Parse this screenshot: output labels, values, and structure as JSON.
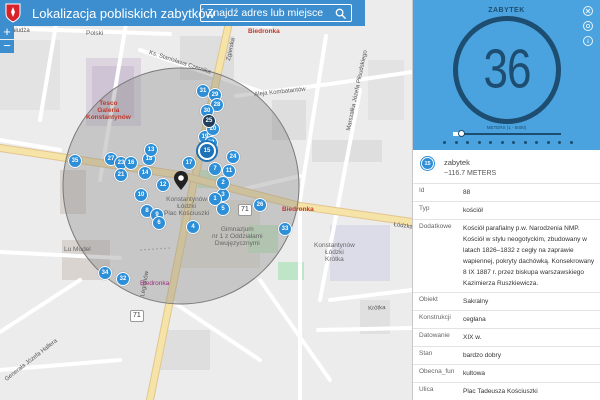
{
  "app": {
    "title": "Lokalizacja pobliskich zabytków",
    "search_label": "Znajdź adres lub miejsce"
  },
  "zoom": {
    "in_label": "+",
    "out_label": "−"
  },
  "map": {
    "pois": {
      "biedronka_top": "Biedronka",
      "biedronka_right": "Biedronka",
      "biedronka_bottom": "Biedronka",
      "tesco": "Tesco\nGaleria\nKonstantynów",
      "gimnazjum": "Gimnazjum\nnr 1 z Oddziałami\nDwujęzycznymi",
      "plac": "Konstantynów\nŁódzki\nPlac Kościuszki",
      "konstantynow_right": "Konstantynów\nŁódzki\nKrótka",
      "polski": "Polski",
      "lu_model": "Lu Model"
    },
    "streets": {
      "saturn": "Sałudża",
      "czernika": "Ks. Stanisława Czernika",
      "kombatantow": "Aleja Kombatantów",
      "zgierska": "Zgierska",
      "lodzka": "Łódzka",
      "legionow": "Legionów",
      "krotka": "Krótka",
      "gen": "Generała Józefa Hallera",
      "marszalka": "Marszałka Józefa Piłsudskiego"
    },
    "road_numbers": [
      "71",
      "71"
    ],
    "colors": {
      "marker": "#2e8fd9",
      "marker_dark": "#1f3f5c",
      "buffer": "#8c8c8c"
    }
  },
  "markers": [
    {
      "label": "35"
    },
    {
      "label": "27"
    },
    {
      "label": "23"
    },
    {
      "label": "16"
    },
    {
      "label": "18"
    },
    {
      "label": "13"
    },
    {
      "label": "21"
    },
    {
      "label": "10"
    },
    {
      "label": "14"
    },
    {
      "label": "12"
    },
    {
      "label": "8"
    },
    {
      "label": "9"
    },
    {
      "label": "6"
    },
    {
      "label": "5"
    },
    {
      "label": "4"
    },
    {
      "label": "3"
    },
    {
      "label": "2"
    },
    {
      "label": "1"
    },
    {
      "label": "7"
    },
    {
      "label": "11"
    },
    {
      "label": "17"
    },
    {
      "label": "19"
    },
    {
      "label": "20"
    },
    {
      "label": "22"
    },
    {
      "label": "26"
    },
    {
      "label": "33"
    },
    {
      "label": "34"
    },
    {
      "label": "32"
    },
    {
      "label": "31"
    },
    {
      "label": "29"
    },
    {
      "label": "28"
    },
    {
      "label": "30"
    },
    {
      "label": "25"
    },
    {
      "label": "24"
    }
  ],
  "panel": {
    "title": "ZABYTEK",
    "counter": "36",
    "slider_label": "METERS (1 - 5000)",
    "slider_fraction": 0.08,
    "item": {
      "number": "15",
      "type": "zabytek",
      "distance": "~116.7 METERS"
    },
    "attributes": [
      {
        "key": "Id",
        "value": "88"
      },
      {
        "key": "Typ",
        "value": "kościół"
      },
      {
        "key": "Dodatkowe",
        "value": "Kościół parafialny p.w. Narodzenia NMP. Kościół w stylu neogotyckim, zbudowany w latach 1826–1832 z cegły na zaprawie wapiennej, pokryty dachówką. Konsekrowany 8 IX 1887 r. przez biskupa warszawskiego Kazimierza Ruszkiewicza."
      },
      {
        "key": "Obiekt",
        "value": "Sakralny"
      },
      {
        "key": "Konstrukcji",
        "value": "cegłana"
      },
      {
        "key": "Datowanie",
        "value": "XIX w."
      },
      {
        "key": "Stan",
        "value": "bardzo dobry"
      },
      {
        "key": "Obecna_fun",
        "value": "kultowa"
      },
      {
        "key": "Ulica",
        "value": "Plac Tadeusza Kościuszki"
      }
    ]
  }
}
